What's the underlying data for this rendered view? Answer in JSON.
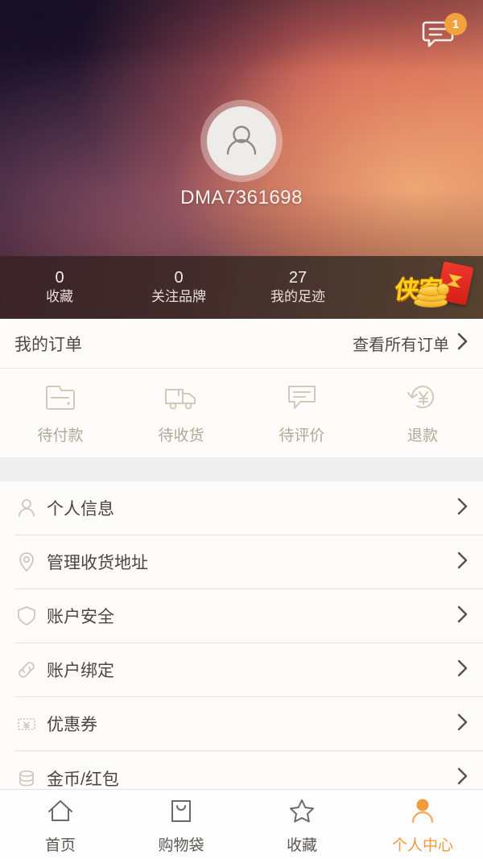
{
  "hero": {
    "username": "DMA7361698",
    "avatar_icon": "person-avatar-icon",
    "message_icon": "message-bubble-icon",
    "message_badge": "1",
    "badge_color": "#f2a13c"
  },
  "stats": {
    "items": [
      {
        "value": "0",
        "label": "收藏"
      },
      {
        "value": "0",
        "label": "关注品牌"
      },
      {
        "value": "27",
        "label": "我的足迹"
      }
    ],
    "brand": {
      "text": "侠客",
      "logo_color": "#ffd21a",
      "envelope_color": "#e02a20",
      "coin_color": "#f2ad1e"
    }
  },
  "orders": {
    "title": "我的订单",
    "more_label": "查看所有订单",
    "more_icon": "chevron-right-icon",
    "items": [
      {
        "label": "待付款",
        "icon": "wallet-icon"
      },
      {
        "label": "待收货",
        "icon": "truck-icon"
      },
      {
        "label": "待评价",
        "icon": "comment-icon"
      },
      {
        "label": "退款",
        "icon": "refund-yen-icon"
      }
    ]
  },
  "menu": {
    "items": [
      {
        "label": "个人信息",
        "icon": "person-icon"
      },
      {
        "label": "管理收货地址",
        "icon": "location-pin-icon"
      },
      {
        "label": "账户安全",
        "icon": "shield-icon"
      },
      {
        "label": "账户绑定",
        "icon": "link-icon"
      },
      {
        "label": "优惠券",
        "icon": "coupon-yen-icon"
      },
      {
        "label": "金币/红包",
        "icon": "coin-stack-icon"
      }
    ],
    "chevron_icon": "chevron-right-icon"
  },
  "tabbar": {
    "active_color": "#ef9b3e",
    "items": [
      {
        "label": "首页",
        "icon": "home-icon",
        "active": false
      },
      {
        "label": "购物袋",
        "icon": "shopping-bag-icon",
        "active": false
      },
      {
        "label": "收藏",
        "icon": "star-icon",
        "active": false
      },
      {
        "label": "个人中心",
        "icon": "user-center-icon",
        "active": true
      }
    ]
  }
}
